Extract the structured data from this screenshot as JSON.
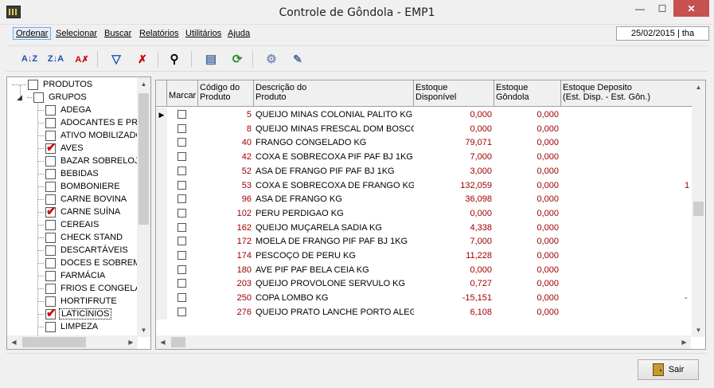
{
  "window": {
    "title": "Controle de Gôndola - EMP1",
    "minimize_glyph": "—",
    "maximize_glyph": "☐",
    "close_glyph": "✕"
  },
  "menu": {
    "items": [
      "Ordenar",
      "Selecionar",
      "Buscar",
      "Relatórios",
      "Utilitários",
      "Ajuda"
    ],
    "status": "25/02/2015 | tha"
  },
  "toolbar": {
    "buttons": [
      {
        "icon": "sort-ascending-icon",
        "glyph": "A↓Z"
      },
      {
        "icon": "sort-descending-icon",
        "glyph": "Z↓A"
      },
      {
        "icon": "clear-sort-icon",
        "glyph": "A✗"
      },
      {
        "icon": "filter-icon",
        "glyph": "▽"
      },
      {
        "icon": "clear-filter-icon",
        "glyph": "✗"
      },
      {
        "icon": "find-binoculars-icon",
        "glyph": "⚲"
      },
      {
        "icon": "columns-icon",
        "glyph": "▤"
      },
      {
        "icon": "refresh-icon",
        "glyph": "⟳"
      },
      {
        "icon": "settings-icon",
        "glyph": "⚙"
      },
      {
        "icon": "tools-icon",
        "glyph": "✎"
      }
    ]
  },
  "tree": {
    "root": "PRODUTOS",
    "groups_label": "GRUPOS",
    "items": [
      {
        "label": "ADEGA",
        "checked": false
      },
      {
        "label": "ADOCANTES E PRO",
        "checked": false
      },
      {
        "label": "ATIVO MOBILIZADO",
        "checked": false
      },
      {
        "label": "AVES",
        "checked": true
      },
      {
        "label": "BAZAR SOBRELOJA",
        "checked": false
      },
      {
        "label": "BEBIDAS",
        "checked": false
      },
      {
        "label": "BOMBONIERE",
        "checked": false
      },
      {
        "label": "CARNE BOVINA",
        "checked": false
      },
      {
        "label": "CARNE SUÍNA",
        "checked": true
      },
      {
        "label": "CEREAIS",
        "checked": false
      },
      {
        "label": "CHECK STAND",
        "checked": false
      },
      {
        "label": "DESCARTÁVEIS",
        "checked": false
      },
      {
        "label": "DOCES E SOBREME",
        "checked": false
      },
      {
        "label": "FARMÁCIA",
        "checked": false
      },
      {
        "label": "FRIOS E CONGELAD",
        "checked": false
      },
      {
        "label": "HORTIFRUTE",
        "checked": false
      },
      {
        "label": "LATICÍNIOS",
        "checked": true
      },
      {
        "label": "LIMPEZA",
        "checked": false
      }
    ]
  },
  "grid": {
    "headers": [
      "Marcar",
      "Código do\nProduto",
      "Descrição do\nProduto",
      "Estoque\nDisponível",
      "Estoque\nGôndola",
      "Estoque Deposito\n(Est. Disp. - Est. Gôn.)"
    ],
    "rows": [
      {
        "codigo": "5",
        "descricao": "QUEIJO MINAS COLONIAL PALITO KG",
        "disponivel": "0,000",
        "gondola": "0,000",
        "deposito": ""
      },
      {
        "codigo": "8",
        "descricao": "QUEIJO MINAS FRESCAL DOM BOSCO",
        "disponivel": "0,000",
        "gondola": "0,000",
        "deposito": ""
      },
      {
        "codigo": "40",
        "descricao": "FRANGO CONGELADO KG",
        "disponivel": "79,071",
        "gondola": "0,000",
        "deposito": ""
      },
      {
        "codigo": "42",
        "descricao": "COXA E SOBRECOXA PIF PAF BJ 1KG",
        "disponivel": "7,000",
        "gondola": "0,000",
        "deposito": ""
      },
      {
        "codigo": "52",
        "descricao": "ASA DE FRANGO PIF PAF BJ 1KG",
        "disponivel": "3,000",
        "gondola": "0,000",
        "deposito": ""
      },
      {
        "codigo": "53",
        "descricao": "COXA E SOBRECOXA DE FRANGO KG",
        "disponivel": "132,059",
        "gondola": "0,000",
        "deposito": "1"
      },
      {
        "codigo": "96",
        "descricao": "ASA DE FRANGO KG",
        "disponivel": "36,098",
        "gondola": "0,000",
        "deposito": ""
      },
      {
        "codigo": "102",
        "descricao": "PERU PERDIGAO KG",
        "disponivel": "0,000",
        "gondola": "0,000",
        "deposito": ""
      },
      {
        "codigo": "162",
        "descricao": "QUEIJO MUÇARELA SADIA KG",
        "disponivel": "4,338",
        "gondola": "0,000",
        "deposito": ""
      },
      {
        "codigo": "172",
        "descricao": "MOELA DE FRANGO PIF PAF BJ 1KG",
        "disponivel": "7,000",
        "gondola": "0,000",
        "deposito": ""
      },
      {
        "codigo": "174",
        "descricao": "PESCOÇO DE PERU KG",
        "disponivel": "11,228",
        "gondola": "0,000",
        "deposito": ""
      },
      {
        "codigo": "180",
        "descricao": "AVE PIF PAF BELA CEIA KG",
        "disponivel": "0,000",
        "gondola": "0,000",
        "deposito": ""
      },
      {
        "codigo": "203",
        "descricao": "QUEIJO PROVOLONE SERVULO KG",
        "disponivel": "0,727",
        "gondola": "0,000",
        "deposito": ""
      },
      {
        "codigo": "250",
        "descricao": "COPA LOMBO KG",
        "disponivel": "-15,151",
        "gondola": "0,000",
        "deposito": "-"
      },
      {
        "codigo": "276",
        "descricao": "QUEIJO PRATO LANCHE PORTO ALEG",
        "disponivel": "6,108",
        "gondola": "0,000",
        "deposito": ""
      }
    ]
  },
  "footer": {
    "exit_label": "Sair"
  }
}
